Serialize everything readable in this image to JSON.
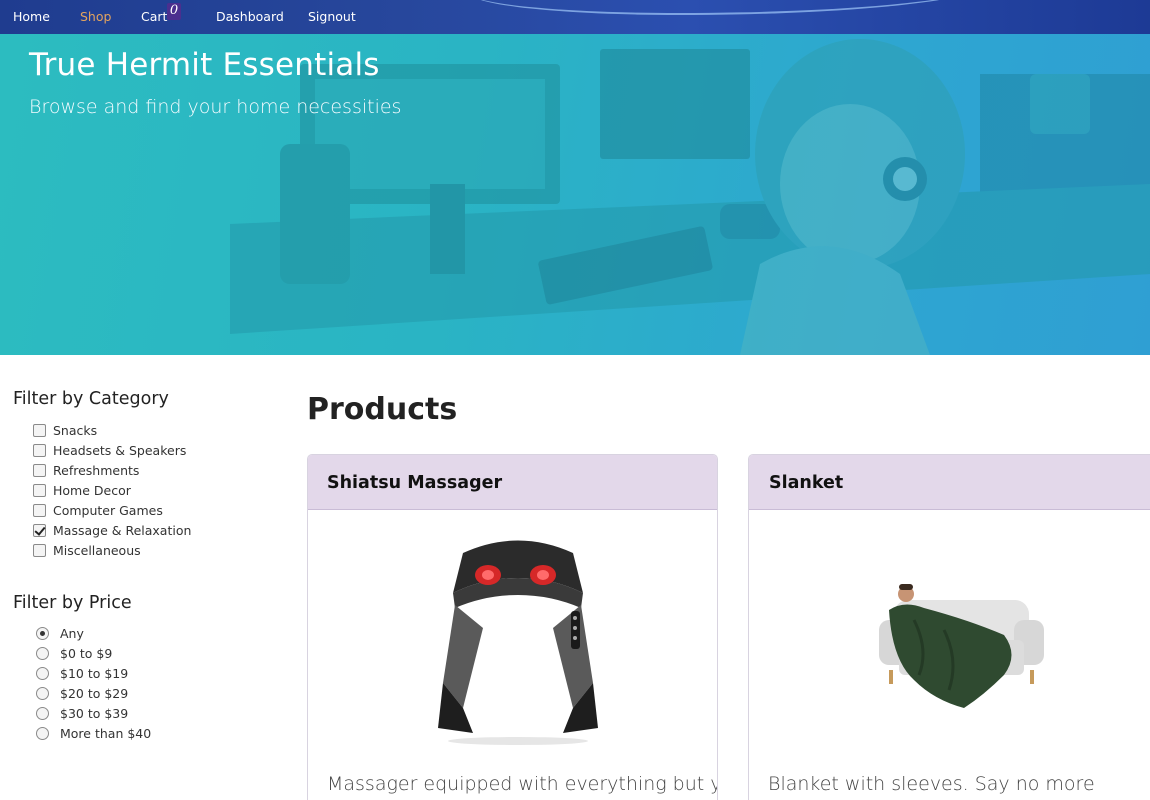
{
  "nav": {
    "home": "Home",
    "shop": "Shop",
    "cart": "Cart",
    "cart_count": "0",
    "dashboard": "Dashboard",
    "signout": "Signout",
    "active": "Shop"
  },
  "hero": {
    "title": "True Hermit Essentials",
    "subtitle": "Browse and find your home necessities"
  },
  "filters": {
    "category_heading": "Filter by Category",
    "categories": [
      {
        "label": "Snacks",
        "checked": false
      },
      {
        "label": "Headsets & Speakers",
        "checked": false
      },
      {
        "label": "Refreshments",
        "checked": false
      },
      {
        "label": "Home Decor",
        "checked": false
      },
      {
        "label": "Computer Games",
        "checked": false
      },
      {
        "label": "Massage & Relaxation",
        "checked": true
      },
      {
        "label": "Miscellaneous",
        "checked": false
      }
    ],
    "price_heading": "Filter by Price",
    "prices": [
      {
        "label": "Any",
        "checked": true
      },
      {
        "label": "$0 to $9",
        "checked": false
      },
      {
        "label": "$10 to $19",
        "checked": false
      },
      {
        "label": "$20 to $29",
        "checked": false
      },
      {
        "label": "$30 to $39",
        "checked": false
      },
      {
        "label": "More than $40",
        "checked": false
      }
    ]
  },
  "main": {
    "title": "Products",
    "products": [
      {
        "name": "Shiatsu Massager",
        "description": "Massager equipped with everything but you",
        "image_icon": "neck-massager-image"
      },
      {
        "name": "Slanket",
        "description": "Blanket with sleeves. Say no more",
        "image_icon": "sleeved-blanket-image"
      }
    ]
  },
  "colors": {
    "nav_bg": "#27479c",
    "nav_active": "#e3a35f",
    "hero_bg": "#2cb5c6",
    "card_header_bg": "#e3d8ea"
  }
}
